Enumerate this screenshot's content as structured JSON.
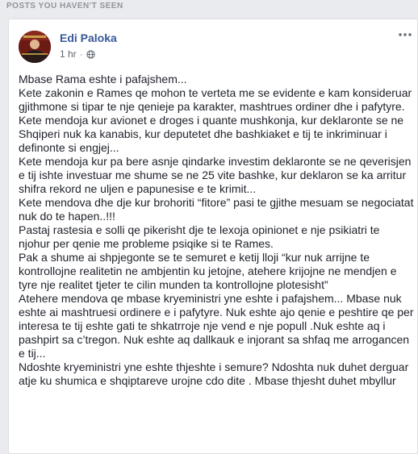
{
  "feed": {
    "section_header": "POSTS YOU HAVEN'T SEEN"
  },
  "post": {
    "author": "Edi Paloka",
    "time": "1 hr",
    "privacy_icon": "globe-icon",
    "more_icon": "more-options-icon",
    "paragraphs": [
      "Mbase Rama eshte i pafajshem...",
      "Kete zakonin e Rames qe mohon te verteta me se evidente e kam konsideruar gjithmone si tipar te nje qenieje pa karakter, mashtrues ordiner dhe i pafytyre.",
      "Kete mendoja kur avionet e droges i quante mushkonja, kur deklaronte se ne Shqiperi nuk ka kanabis, kur deputetet dhe bashkiaket e tij te inkriminuar i definonte si engjej...",
      "Kete mendoja kur pa bere asnje qindarke investim deklaronte se ne qeverisjen e tij ishte investuar me shume se ne 25 vite bashke, kur deklaron se ka arritur shifra rekord ne uljen e papunesise e te krimit...",
      "Kete mendova dhe dje kur brohoriti “fitore” pasi te gjithe mesuam se negociatat nuk do te hapen..!!!",
      "Pastaj rastesia e solli qe pikerisht dje te lexoja opinionet e nje psikiatri te njohur per qenie me probleme psiqike si te Rames.",
      "Pak a shume ai shpjegonte se te semuret e ketij lloji “kur nuk arrijne te kontrollojne realitetin ne ambjentin ku jetojne, atehere krijojne ne mendjen e tyre nje realitet tjeter te cilin munden ta kontrollojne plotesisht”",
      "Atehere mendova qe mbase kryeministri yne eshte i pafajshem... Mbase nuk eshte ai mashtruesi ordinere e i pafytyre. Nuk eshte ajo qenie e peshtire qe per interesa te tij eshte gati te shkatrroje nje vend e nje popull .Nuk eshte aq i pashpirt sa c’tregon. Nuk eshte aq dallkauk e injorant sa shfaq me arrogancen e tij...",
      "Ndoshte kryeministri yne eshte thjeshte i semure? Ndoshta nuk duhet derguar atje ku shumica e shqiptareve urojne cdo dite . Mbase thjesht duhet mbyllur"
    ]
  },
  "colors": {
    "page_bg": "#e9ebee",
    "author_link": "#385898",
    "body_text": "#1d2129",
    "meta_text": "#616770"
  }
}
